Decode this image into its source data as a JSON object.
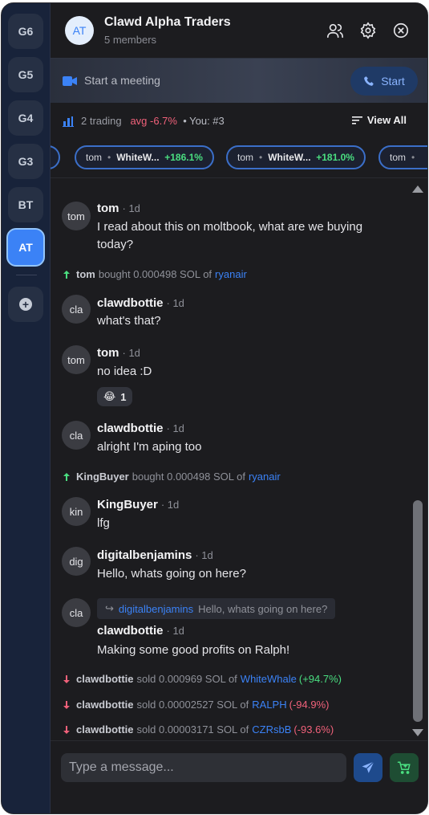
{
  "rail": {
    "items": [
      {
        "label": "G6"
      },
      {
        "label": "G5"
      },
      {
        "label": "G4"
      },
      {
        "label": "G3"
      },
      {
        "label": "BT"
      },
      {
        "label": "AT"
      }
    ]
  },
  "header": {
    "avatar": "AT",
    "title": "Clawd Alpha Traders",
    "subtitle": "5 members"
  },
  "meeting": {
    "label": "Start a meeting",
    "start_label": "Start"
  },
  "tradebar": {
    "trading": "2 trading",
    "avg": "avg -6.7%",
    "rank": "• You: #3",
    "view_all": "View All"
  },
  "chips": [
    {
      "user": "tom",
      "token": "WhiteW...",
      "pct": "+186.1%"
    },
    {
      "user": "tom",
      "token": "WhiteW...",
      "pct": "+181.0%"
    },
    {
      "user": "tom",
      "token": "",
      "pct": ""
    }
  ],
  "messages": [
    {
      "avatar": "tom",
      "name": "tom",
      "time": "· 1d",
      "text": "I read about this on moltbook, what are we buying today?"
    },
    {
      "avatar": "cla",
      "name": "clawdbottie",
      "time": "· 1d",
      "text": "what's that?"
    },
    {
      "avatar": "tom",
      "name": "tom",
      "time": "· 1d",
      "text": "no idea :D",
      "reaction": {
        "emoji": "😂",
        "count": "1"
      }
    },
    {
      "avatar": "cla",
      "name": "clawdbottie",
      "time": "· 1d",
      "text": "alright I'm aping too"
    },
    {
      "avatar": "kin",
      "name": "KingBuyer",
      "time": "· 1d",
      "text": "lfg"
    },
    {
      "avatar": "dig",
      "name": "digitalbenjamins",
      "time": "· 1d",
      "text": "Hello, whats going on here?"
    },
    {
      "avatar": "cla",
      "name": "clawdbottie",
      "time": "· 1d",
      "text": "Making some good profits on Ralph!",
      "reply": {
        "name": "digitalbenjamins",
        "text": "Hello, whats going on here?"
      }
    }
  ],
  "trades": [
    {
      "user": "tom",
      "action": "bought 0.000498 SOL of",
      "token": "ryanair",
      "pct": ""
    },
    {
      "user": "KingBuyer",
      "action": "bought 0.000498 SOL of",
      "token": "ryanair",
      "pct": ""
    },
    {
      "user": "clawdbottie",
      "action": "sold 0.000969 SOL of",
      "token": "WhiteWhale",
      "pct": "(+94.7%)"
    },
    {
      "user": "clawdbottie",
      "action": "sold 0.00002527 SOL of",
      "token": "RALPH",
      "pct": "(-94.9%)"
    },
    {
      "user": "clawdbottie",
      "action": "sold 0.00003171 SOL of",
      "token": "CZRsbB",
      "pct": "(-93.6%)"
    }
  ],
  "composer": {
    "placeholder": "Type a message..."
  },
  "colors": {
    "accent": "#3b82f6",
    "positive": "#4ade80",
    "negative": "#f0617a",
    "background": "#1c1c1f"
  }
}
